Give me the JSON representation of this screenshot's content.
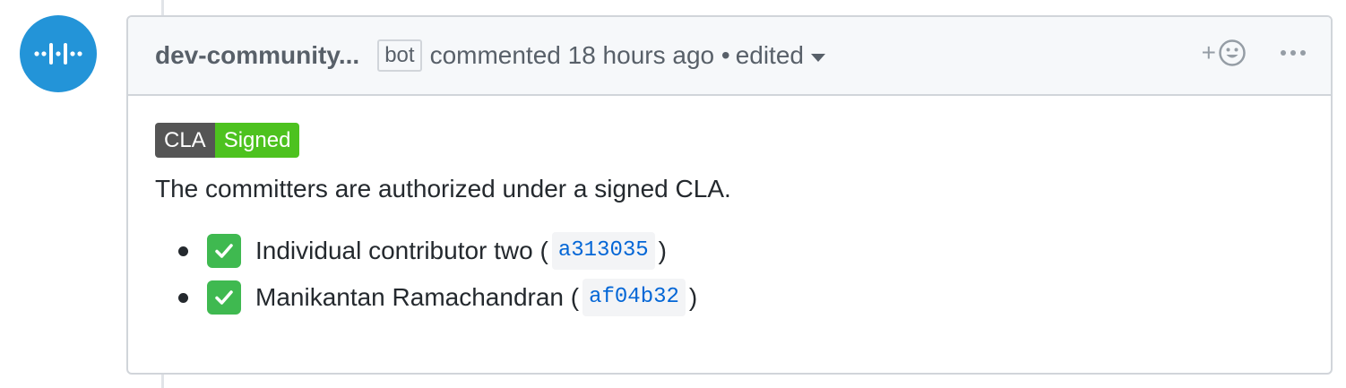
{
  "comment": {
    "author": "dev-community...",
    "author_label": "bot",
    "meta": "commented 18 hours ago •",
    "edited": "edited",
    "reaction_plus": "+"
  },
  "badge": {
    "left": "CLA",
    "right": "Signed"
  },
  "body": {
    "statement": "The committers are authorized under a signed CLA.",
    "committers": [
      {
        "name": "Individual contributor two",
        "sha": "a313035"
      },
      {
        "name": "Manikantan Ramachandran",
        "sha": "af04b32"
      }
    ]
  },
  "colors": {
    "avatar_bg": "#2394d8",
    "badge_left": "#555555",
    "badge_right": "#4dc21f",
    "check": "#3fb950",
    "link": "#0366d6"
  },
  "icons": {
    "avatar": "dev-community-logo-icon",
    "reaction": "smiley-icon",
    "more": "kebab-horizontal-icon",
    "check": "white-check-mark-icon",
    "caret": "caret-down-icon"
  }
}
